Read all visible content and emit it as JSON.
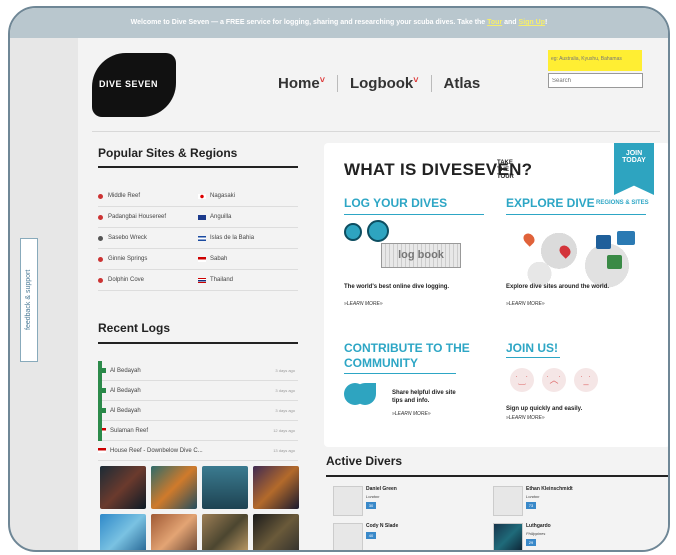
{
  "banner": {
    "text": "Welcome to Dive Seven — a FREE service for logging, sharing and researching your scuba dives. Take the ",
    "tour_label": "Tour",
    "and_text": " and ",
    "signup_label": "Sign Up",
    "end": "!"
  },
  "feedback_tab": {
    "label": "feedback & support"
  },
  "logo": {
    "text": "DIVE SEVEN"
  },
  "nav": {
    "items": [
      {
        "label": "Home"
      },
      {
        "label": "Logbook"
      },
      {
        "label": "Atlas"
      }
    ]
  },
  "search": {
    "hint": "eg: Australia, Kyushu, Bahamas",
    "placeholder": "Search"
  },
  "popular": {
    "title": "Popular Sites & Regions",
    "rows": [
      [
        "Middle Reef",
        "Nagasaki"
      ],
      [
        "Padangbai Housereef",
        "Anguilla"
      ],
      [
        "Sasebo Wreck",
        "Islas de la Bahia"
      ],
      [
        "Ginnie Springs",
        "Sabah"
      ],
      [
        "Dolphin Cove",
        "Thailand"
      ]
    ]
  },
  "recent": {
    "title": "Recent Logs",
    "rows": [
      {
        "name": "Al Bedayah",
        "date": "3 days ago"
      },
      {
        "name": "Al Bedayah",
        "date": "3 days ago"
      },
      {
        "name": "Al Bedayah",
        "date": "3 days ago"
      },
      {
        "name": "Sulaman Reef",
        "date": "12 days ago"
      },
      {
        "name": "House Reef - Downbelow Dive C...",
        "date": "13 days ago"
      }
    ]
  },
  "card": {
    "ribbon": "JOIN TODAY",
    "title": "WHAT IS DIVESEVEN?",
    "tour": "TAKE THE TOUR",
    "log_title": "LOG YOUR DIVES",
    "log_text": "The world's best online dive logging.",
    "explore_title": "EXPLORE DIVE",
    "explore_sub": "REGIONS & SITES",
    "explore_text": "Explore dive sites around the world.",
    "contribute_title_1": "CONTRIBUTE TO THE",
    "contribute_title_2": "COMMUNITY",
    "contribute_text": "Share helpful dive site tips and info.",
    "join_title": "JOIN US!",
    "join_text": "Sign up quickly and easily.",
    "learn_more": "»LEARN MORE»",
    "logbook_label": "log book"
  },
  "active": {
    "title": "Active Divers",
    "divers": [
      {
        "name": "Daniel Green",
        "location": "London",
        "count": "30"
      },
      {
        "name": "Ethan Kleinschmidt",
        "location": "London",
        "count": "73"
      },
      {
        "name": "Cody N Slade",
        "location": "",
        "count": "40"
      },
      {
        "name": "Luthgardo",
        "location": "Philippines",
        "count": "29"
      }
    ]
  },
  "colors": {
    "accent": "#2da6c5",
    "banner": "#b9c7ce",
    "highlight": "#ffee33"
  }
}
